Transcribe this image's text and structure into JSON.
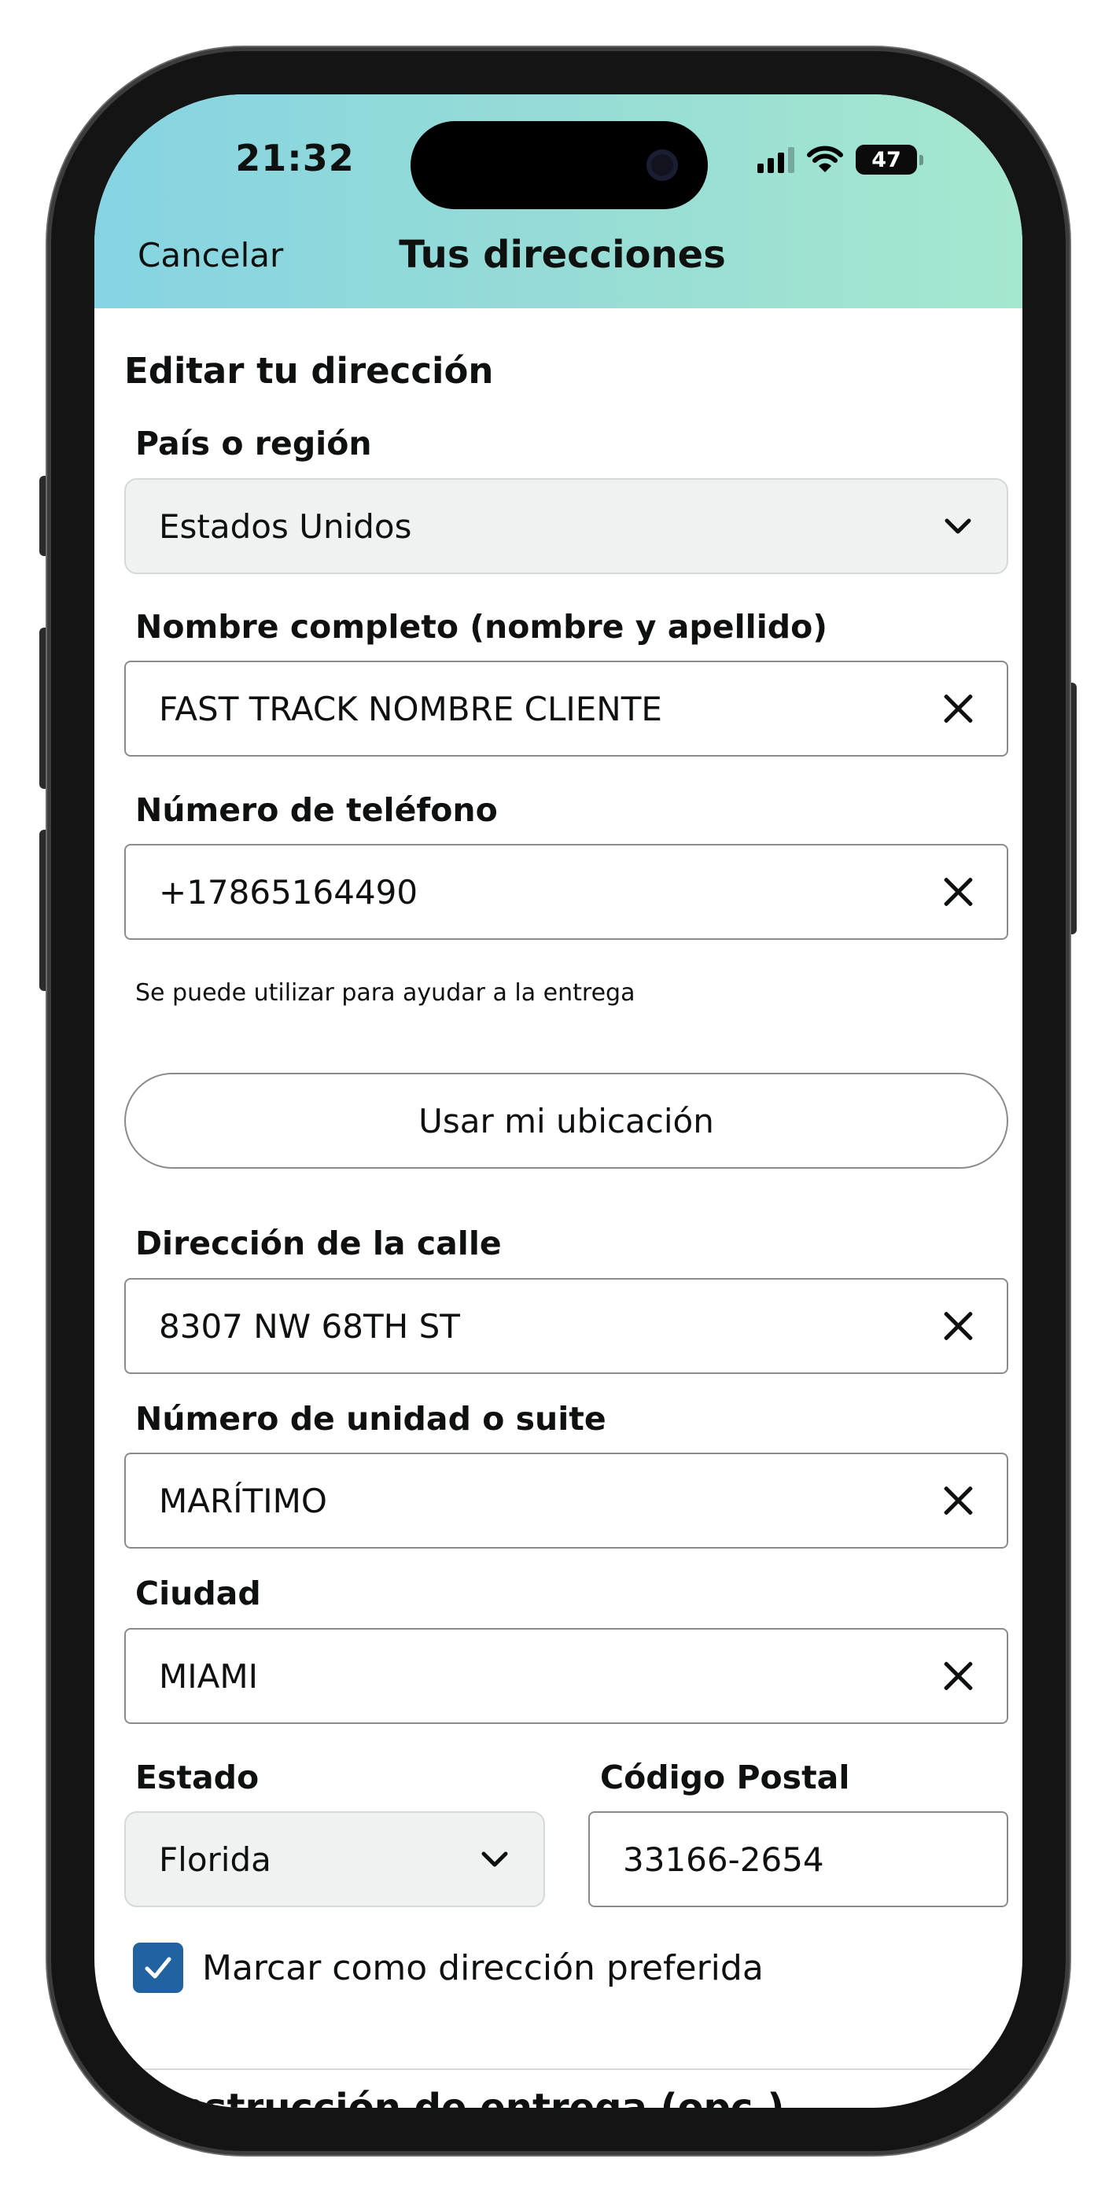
{
  "status_bar": {
    "time": "21:32",
    "battery": "47",
    "battery_level": 0.47
  },
  "nav": {
    "cancel": "Cancelar",
    "title": "Tus direcciones"
  },
  "form": {
    "heading": "Editar tu dirección",
    "country": {
      "label": "País o región",
      "value": "Estados Unidos"
    },
    "full_name": {
      "label": "Nombre completo (nombre y apellido)",
      "value": "FAST TRACK NOMBRE CLIENTE"
    },
    "phone": {
      "label": "Número de teléfono",
      "value": "+17865164490",
      "hint": "Se puede utilizar para ayudar a la entrega"
    },
    "use_location": "Usar mi ubicación",
    "street": {
      "label": "Dirección de la calle",
      "value": "8307 NW 68TH ST"
    },
    "unit": {
      "label": "Número de unidad o suite",
      "value": "MARÍTIMO"
    },
    "city": {
      "label": "Ciudad",
      "value": "MIAMI"
    },
    "state": {
      "label": "Estado",
      "value": "Florida"
    },
    "zip": {
      "label": "Código Postal",
      "value": "33166-2654"
    },
    "preferred": {
      "label": "Marcar como dirección preferida",
      "checked": true
    },
    "delivery_instructions": "Instrucción de entrega (opc.)"
  },
  "icons": {
    "clear": "close-icon",
    "dropdown": "chevron-down-icon",
    "check": "checkmark-icon",
    "signal": "cellular-signal-icon",
    "wifi": "wifi-icon",
    "battery": "battery-icon"
  },
  "colors": {
    "header_gradient_start": "#86d4e3",
    "header_gradient_end": "#a6e7cf",
    "checkbox": "#2162a1",
    "select_bg": "#f0f2f2",
    "field_border": "#888c8c"
  }
}
